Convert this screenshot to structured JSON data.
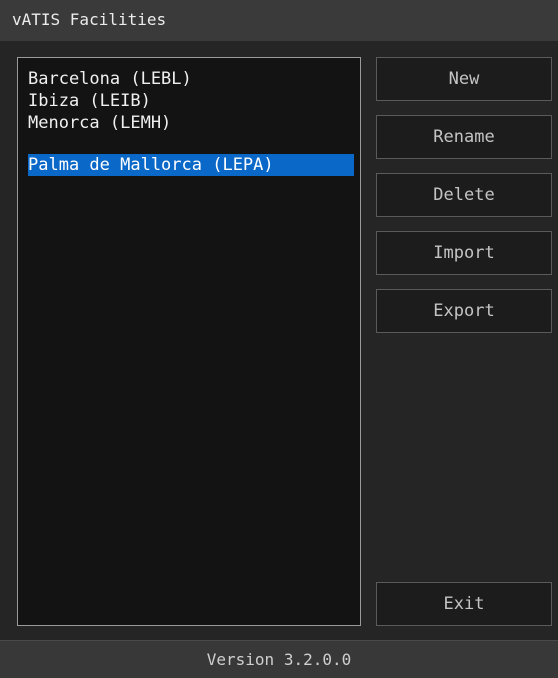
{
  "window": {
    "title": "vATIS Facilities"
  },
  "facilities": {
    "items": [
      {
        "label": "Barcelona (LEBL)",
        "selected": false
      },
      {
        "label": "Ibiza (LEIB)",
        "selected": false
      },
      {
        "label": "Menorca (LEMH)",
        "selected": false
      },
      {
        "label": "Palma de Mallorca (LEPA)",
        "selected": true
      }
    ]
  },
  "buttons": {
    "new_label": "New",
    "rename_label": "Rename",
    "delete_label": "Delete",
    "import_label": "Import",
    "export_label": "Export",
    "exit_label": "Exit"
  },
  "status": {
    "version_text": "Version 3.2.0.0"
  },
  "colors": {
    "selection": "#0a68c8",
    "background": "#252525",
    "title_bar": "#3a3a3a"
  }
}
